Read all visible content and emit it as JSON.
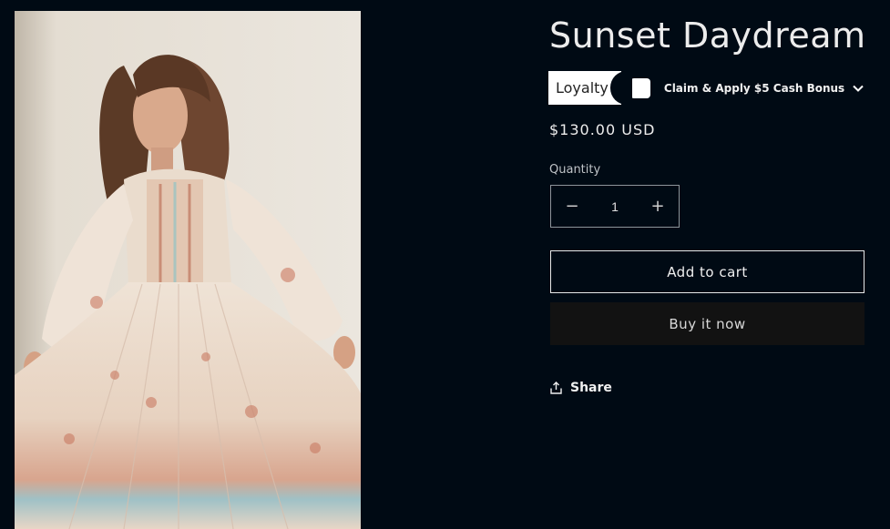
{
  "product": {
    "title": "Sunset Daydream",
    "price": "$130.00 USD",
    "image_alt": "Woman wearing a floral boho dress"
  },
  "loyalty": {
    "label": "Loyalty",
    "cta": "Claim & Apply $5 Cash Bonus"
  },
  "quantity": {
    "label": "Quantity",
    "value": "1",
    "decrement": "−",
    "increment": "+"
  },
  "actions": {
    "add_to_cart": "Add to cart",
    "buy_now": "Buy it now",
    "share": "Share"
  },
  "colors": {
    "background": "#000a14",
    "button_dark": "#121212",
    "text": "#ececec"
  }
}
